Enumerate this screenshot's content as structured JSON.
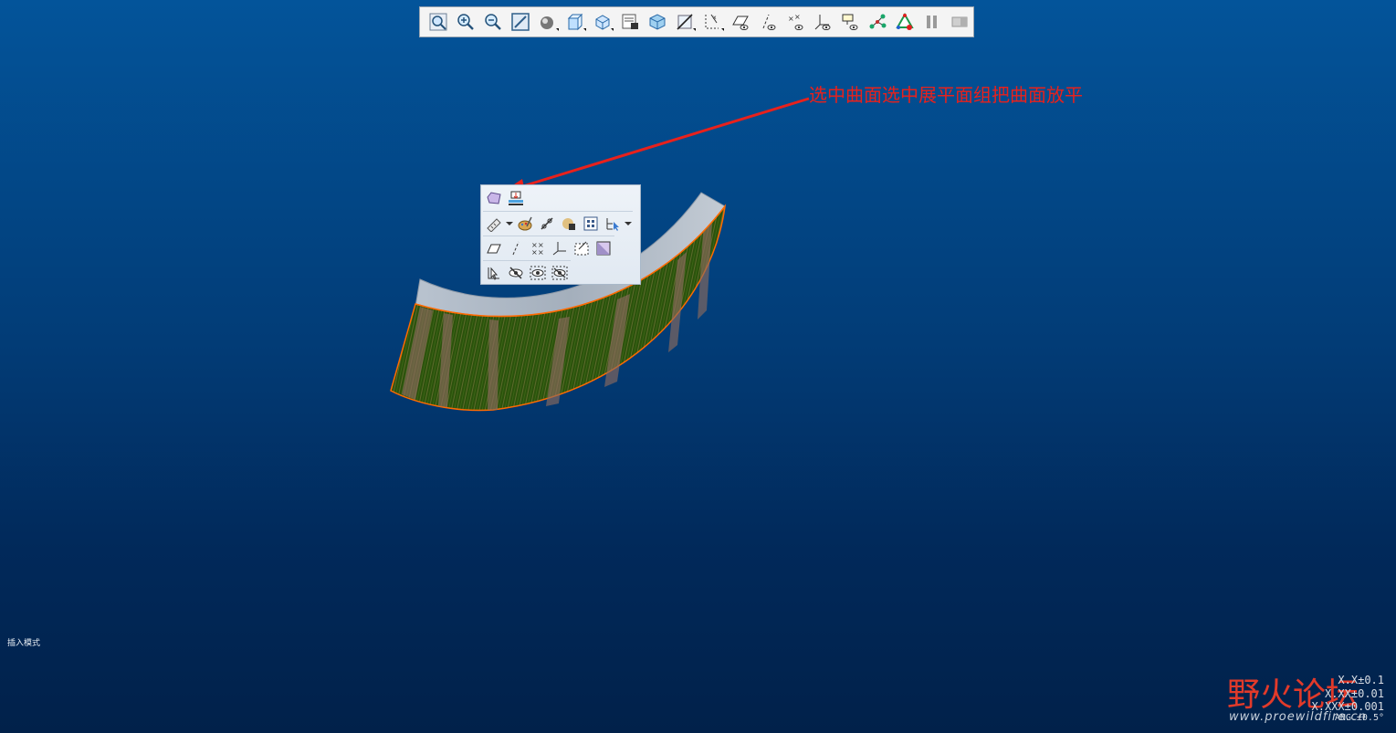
{
  "annotation": {
    "text": "选中曲面选中展平面组把曲面放平",
    "color": "#e8211c"
  },
  "status": {
    "text": "插入模式"
  },
  "watermark": {
    "brand": "野火论坛",
    "url": "www.proewildfire.cn",
    "tolerances": [
      "X.X±0.1",
      "X.XX±0.01",
      "X.XXX±0.001",
      "ANG.±0.5°"
    ]
  },
  "toolbar": {
    "icons": [
      "zoom-fit-icon",
      "zoom-in-icon",
      "zoom-out-icon",
      "reorient-icon",
      "shading-icon",
      "view-box-icon",
      "saved-views-icon",
      "layers-icon",
      "display-style-icon",
      "section-icon",
      "datum-axis-toggle-icon",
      "datum-plane-display-icon",
      "axis-display-icon",
      "point-display-icon",
      "csys-display-icon",
      "annotation-display-icon",
      "spin-center-icon",
      "model-tree-icon",
      "pause-icon",
      "next-icon"
    ]
  },
  "mini_toolbar": {
    "rows": [
      [
        "surface-icon",
        "flatten-quilt-icon"
      ],
      [
        "measure-icon",
        "appearance-icon",
        "chain-icon",
        "shading-style-icon",
        "grid-icon",
        "select-filter-icon"
      ],
      [
        "plane-icon",
        "axis-icon",
        "point-icon",
        "csys-icon",
        "sketch-icon",
        "section-view-icon"
      ],
      [
        "select-icon",
        "hide-icon",
        "show-icon",
        "unhide-all-icon"
      ]
    ]
  },
  "colors": {
    "background_top": "#03549a",
    "background_bottom": "#01214a",
    "surface_top": "#a7b2bf",
    "surface_face": "#2f5a0e",
    "edge_highlight": "#ff6a00"
  }
}
